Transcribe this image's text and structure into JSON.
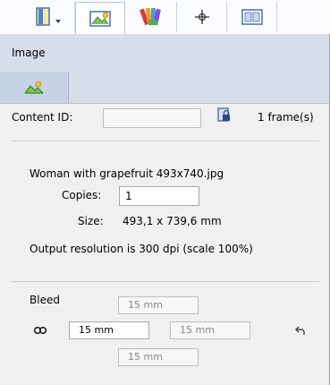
{
  "toolbar": {
    "icons": [
      "document-dropdown-icon",
      "image-icon",
      "swatches-icon",
      "registration-mark-icon",
      "layout-icon"
    ],
    "selected": "image-icon"
  },
  "section": {
    "title": "Image",
    "subtab_icon": "image-icon"
  },
  "content": {
    "id_label": "Content ID:",
    "id_value": "",
    "lock_icon": "lock-icon",
    "frames": "1 frame(s)"
  },
  "file": {
    "name": "Woman with grapefruit 493x740.jpg",
    "copies_label": "Copies:",
    "copies_value": "1",
    "size_label": "Size:",
    "size_value": "493,1 x 739,6 mm",
    "resolution": "Output resolution is 300 dpi (scale 100%)"
  },
  "bleed": {
    "label": "Bleed",
    "top": "15 mm",
    "left": "15 mm",
    "right": "15 mm",
    "bottom": "15 mm",
    "link_icon": "link-icon",
    "reset_icon": "undo-icon"
  },
  "colors": {
    "toolbar_bg": "#fafcff",
    "header_bg": "#d6deea",
    "panel_bg": "#f0f0f0"
  }
}
